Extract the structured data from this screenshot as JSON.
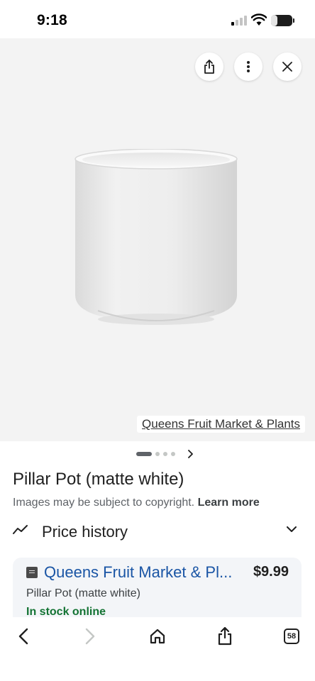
{
  "status_bar": {
    "time": "9:18",
    "battery": "31",
    "battery_level": 0.31
  },
  "viewer": {
    "source_label": "Queens Fruit Market & Plants",
    "buttons": [
      "share-icon",
      "more-vert-icon",
      "close-icon"
    ],
    "background": "#f3f3f3"
  },
  "carousel": {
    "active_index": 0,
    "count": 4
  },
  "product": {
    "title": "Pillar Pot (matte white)",
    "copyright_note": "Images may be subject to copyright.",
    "learn_more": "Learn more"
  },
  "price_history": {
    "label": "Price history"
  },
  "offer": {
    "store": "Queens Fruit Market & Pl...",
    "price": "$9.99",
    "product_name": "Pillar Pot (matte white)",
    "availability": "In stock online",
    "link_color": "#1a55a5",
    "availability_color": "#137333"
  },
  "toolbar": {
    "tabs_count": "58",
    "icons": [
      "back-icon",
      "forward-icon",
      "home-icon",
      "share-icon",
      "tabs-icon"
    ]
  }
}
